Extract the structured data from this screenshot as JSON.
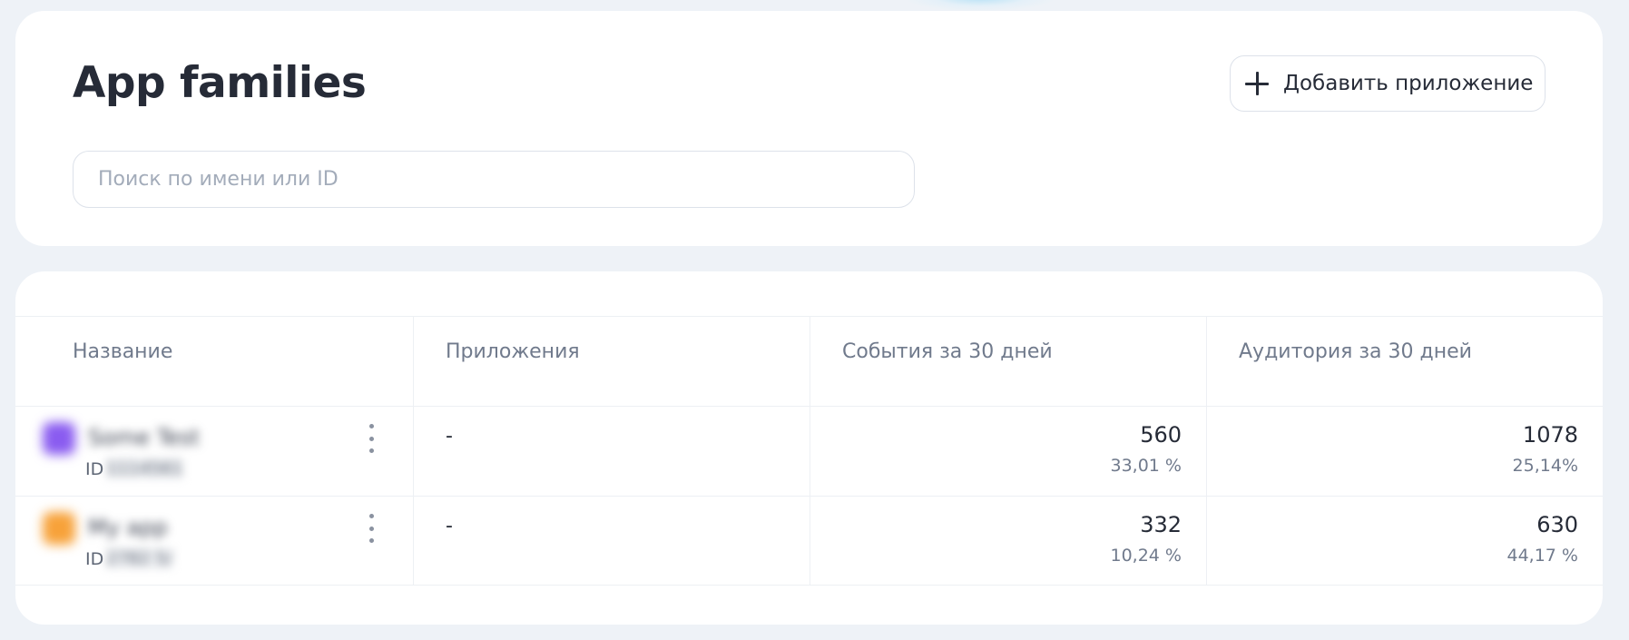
{
  "header": {
    "title": "App families",
    "add_button_label": "Добавить приложение",
    "add_icon": "plus-icon",
    "search": {
      "placeholder": "Поиск по имени или ID",
      "value": ""
    }
  },
  "table": {
    "columns": [
      "Название",
      "Приложения",
      "События за 30 дней",
      "Аудитория за 30 дней"
    ],
    "rows": [
      {
        "name": "Some Test",
        "id_label": "ID",
        "id_value": "1114561",
        "icon_color": "#8a5cf0",
        "apps": "-",
        "events": "560",
        "events_pct": "33,01 %",
        "audience": "1078",
        "audience_pct": "25,14%"
      },
      {
        "name": "My app",
        "id_label": "ID",
        "id_value": "2782 5/",
        "icon_color": "#f7a23a",
        "apps": "-",
        "events": "332",
        "events_pct": "10,24 %",
        "audience": "630",
        "audience_pct": "44,17 %"
      }
    ]
  },
  "colors": {
    "background": "#eef2f7",
    "card": "#ffffff",
    "text": "#262b37",
    "muted": "#707a8c",
    "border": "#dde2ea"
  }
}
